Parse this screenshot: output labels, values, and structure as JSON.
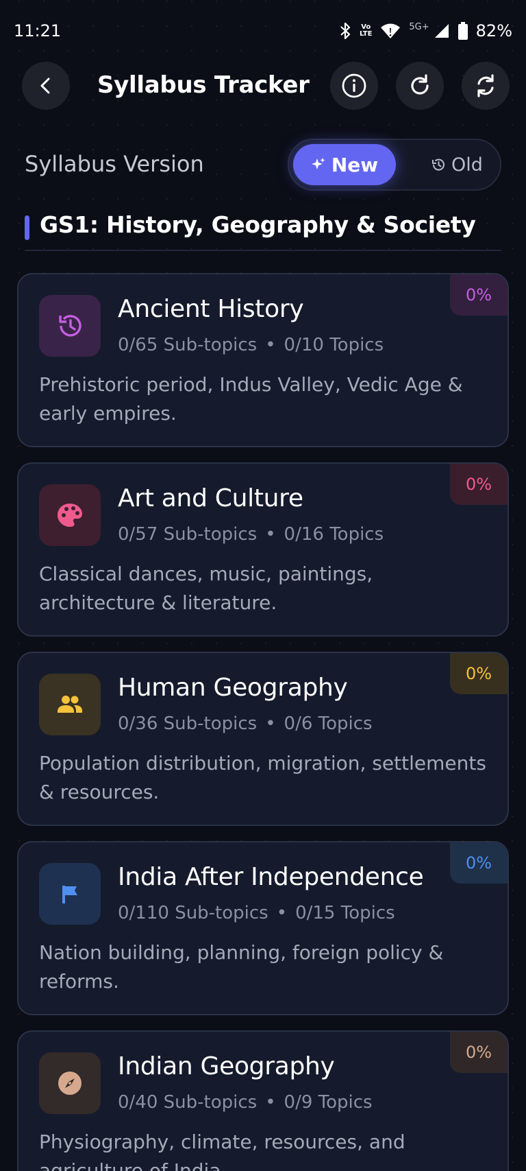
{
  "status_bar": {
    "time": "11:21",
    "signal_label": "5G+",
    "vo_lte_top": "Vo",
    "vo_lte_bottom": "LTE",
    "battery": "82%"
  },
  "header": {
    "title": "Syllabus Tracker"
  },
  "version": {
    "label": "Syllabus Version",
    "new_label": "New",
    "old_label": "Old",
    "selected": "New"
  },
  "section": {
    "title": "GS1: History, Geography & Society",
    "accent": "#6366f1"
  },
  "cards": [
    {
      "title": "Ancient History",
      "subtopics": "0/65 Sub-topics",
      "dot": "•",
      "topics": "0/10 Topics",
      "description": "Prehistoric period, Indus Valley, Vedic Age & early empires.",
      "progress": "0%",
      "icon": "history-icon",
      "accent": "#c45fe0",
      "icon_bg": "#3a2348",
      "badge_bg": "#33203f"
    },
    {
      "title": "Art and Culture",
      "subtopics": "0/57 Sub-topics",
      "dot": "•",
      "topics": "0/16 Topics",
      "description": "Classical dances, music, paintings, architecture & literature.",
      "progress": "0%",
      "icon": "palette-icon",
      "accent": "#f05a8c",
      "icon_bg": "#3d1f30",
      "badge_bg": "#3a1e2c"
    },
    {
      "title": "Human Geography",
      "subtopics": "0/36 Sub-topics",
      "dot": "•",
      "topics": "0/6 Topics",
      "description": "Population distribution, migration, settlements & resources.",
      "progress": "0%",
      "icon": "people-icon",
      "accent": "#f5c23c",
      "icon_bg": "#3a3222",
      "badge_bg": "#38301f"
    },
    {
      "title": "India After Independence",
      "subtopics": "0/110 Sub-topics",
      "dot": "•",
      "topics": "0/15 Topics",
      "description": "Nation building, planning, foreign policy & reforms.",
      "progress": "0%",
      "icon": "flag-icon",
      "accent": "#4f8ff0",
      "icon_bg": "#1f3150",
      "badge_bg": "#1f3049"
    },
    {
      "title": "Indian Geography",
      "subtopics": "0/40 Sub-topics",
      "dot": "•",
      "topics": "0/9 Topics",
      "description": "Physiography, climate, resources, and agriculture of India.",
      "progress": "0%",
      "icon": "compass-icon",
      "accent": "#d6a98e",
      "icon_bg": "#332a2a",
      "badge_bg": "#302828"
    }
  ]
}
